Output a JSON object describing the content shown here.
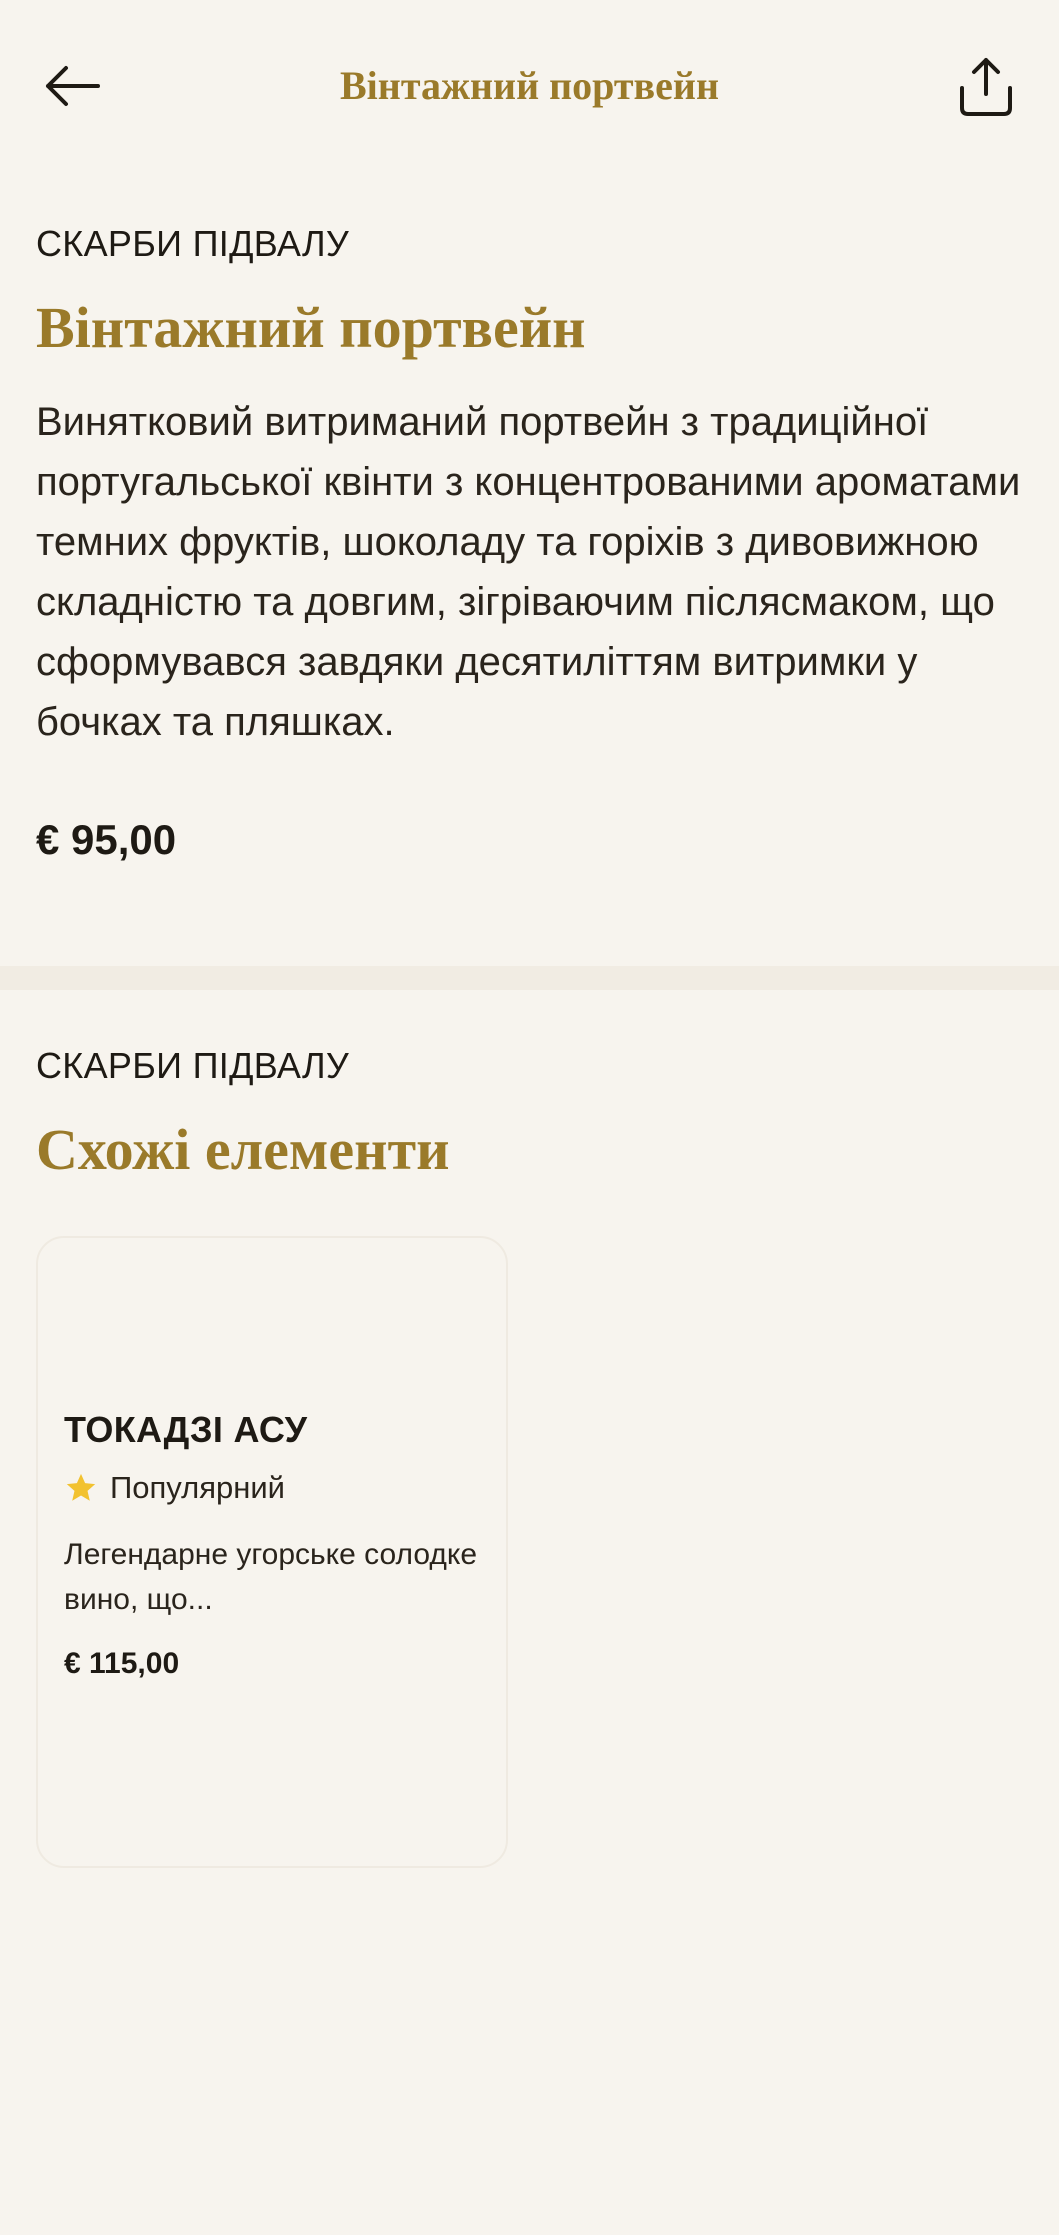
{
  "header": {
    "back_icon": "arrow-left-icon",
    "title": "Вінтажний портвейн",
    "share_icon": "share-icon"
  },
  "product": {
    "category": "СКАРБИ ПІДВАЛУ",
    "title": "Вінтажний портвейн",
    "description": "Винятковий витриманий портвейн з традиційної португальської квінти з концентрованими ароматами темних фруктів, шоколаду та горіхів з дивовижною складністю та довгим, зігріваючим післясмаком, що сформувався завдяки десятиліттям витримки у бочках та пляшках.",
    "price": "€ 95,00"
  },
  "similar": {
    "category": "СКАРБИ ПІДВАЛУ",
    "title": "Схожі елементи",
    "items": [
      {
        "name": "ТОКАДЗІ АСУ",
        "badge": "Популярний",
        "badge_icon": "star-icon",
        "description": "Легендарне угорське солодке вино, що...",
        "price": "€ 115,00"
      }
    ]
  },
  "colors": {
    "background": "#F7F4EE",
    "accent_gold": "#9A7A2A",
    "text": "#1E1A14",
    "star": "#F2C230"
  }
}
